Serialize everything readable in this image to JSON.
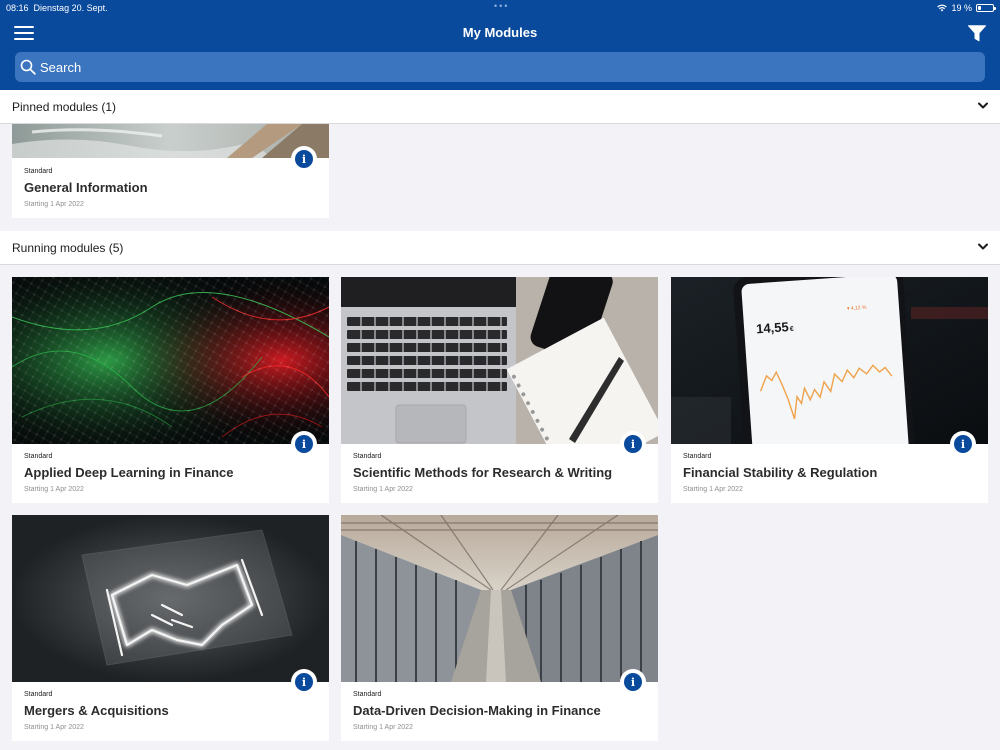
{
  "status_bar": {
    "time": "08:16",
    "date": "Dienstag 20. Sept.",
    "battery": "19 %",
    "battery_level": 0.19
  },
  "header": {
    "title": "My Modules",
    "menu_icon": "hamburger-menu-icon",
    "filter_icon": "filter-funnel-icon"
  },
  "search": {
    "placeholder": "Search",
    "value": ""
  },
  "colors": {
    "brand": "#0a4a9c",
    "search_bg": "#3b75bf",
    "page_bg": "#f2f2f7"
  },
  "sections": {
    "pinned": {
      "label": "Pinned modules (1)",
      "modules": [
        {
          "kind": "Standard",
          "name": "General Information",
          "date": "Starting 1 Apr 2022",
          "image": "water-fountain-photo"
        }
      ]
    },
    "running": {
      "label": "Running modules (5)",
      "modules": [
        {
          "kind": "Standard",
          "name": "Applied Deep Learning in Finance",
          "date": "Starting 1 Apr 2022",
          "image": "neural-network-abstract-photo"
        },
        {
          "kind": "Standard",
          "name": "Scientific Methods for Research & Writing",
          "date": "Starting 1 Apr 2022",
          "image": "laptop-notebook-desk-photo"
        },
        {
          "kind": "Standard",
          "name": "Financial Stability & Regulation",
          "date": "Starting 1 Apr 2022",
          "image": "stock-chart-phone-photo"
        },
        {
          "kind": "Standard",
          "name": "Mergers & Acquisitions",
          "date": "Starting 1 Apr 2022",
          "image": "neon-handshake-photo"
        },
        {
          "kind": "Standard",
          "name": "Data-Driven Decision-Making in Finance",
          "date": "Starting 1 Apr 2022",
          "image": "server-room-photo"
        }
      ]
    }
  },
  "phone_screen": {
    "price": "14,55",
    "currency": "€",
    "change": "▾ 4,12 %"
  }
}
